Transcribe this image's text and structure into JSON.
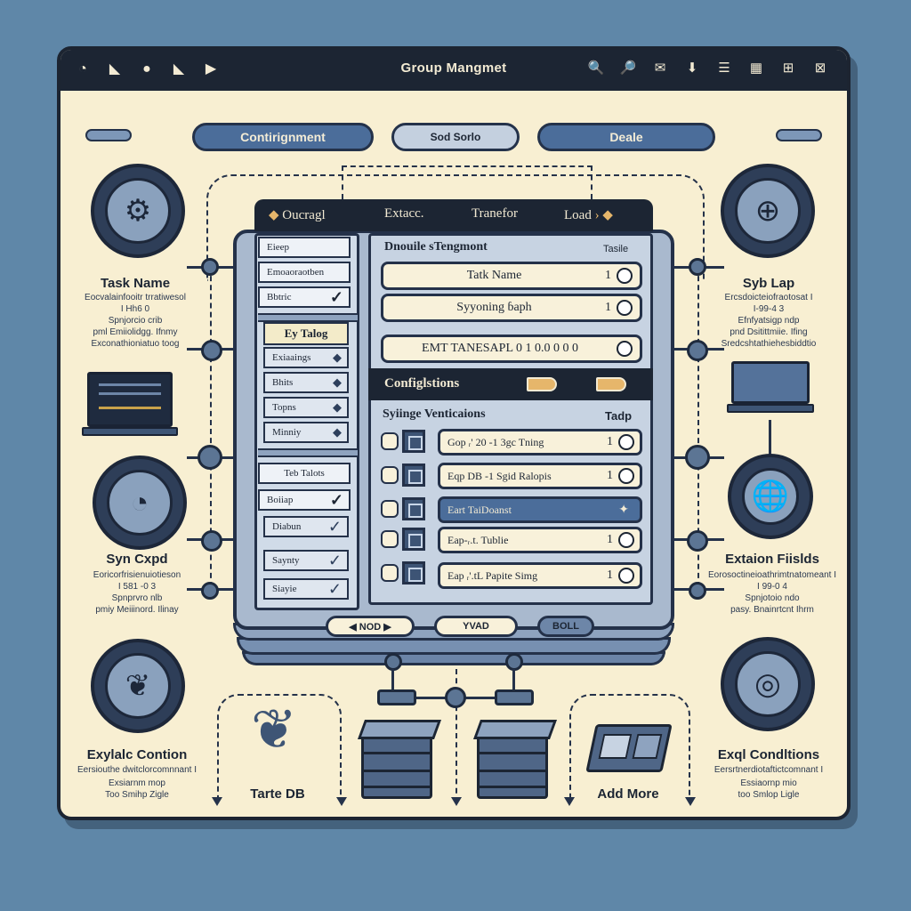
{
  "window": {
    "title": "Group Mangmet",
    "left_icons": [
      "◔",
      "◣",
      "●",
      "◣",
      "▶"
    ],
    "right_icons": [
      "🔍",
      "🔎",
      "✉",
      "⬇",
      "☰",
      "▦",
      "⊞",
      "⊠"
    ]
  },
  "top_buttons": {
    "left": "Contirignment",
    "center": "Sod Sorlo",
    "right": "Deale"
  },
  "tabs": {
    "t1": "Oucragl",
    "t2": "Extacc.",
    "t3": "Tranefor",
    "t4": "Load",
    "arrow": "›"
  },
  "left_column": {
    "items": [
      "Eieep",
      "Emoaoraotben",
      "Bbtric"
    ],
    "group1_title": "Ey Talog",
    "group1": [
      "Exiaaings",
      "Bhits",
      "Topns",
      "Minniy"
    ],
    "group2_title": "Teb Talots",
    "group2": [
      "Boiiap",
      "Diabun",
      "Saynty",
      "Siayie"
    ]
  },
  "details": {
    "title": "Dnouile sTengmont",
    "tag": "Tasile",
    "fields": [
      {
        "label": "Tatk Name",
        "num": "1"
      },
      {
        "label": "Syyoning ɓaph",
        "num": "1"
      },
      {
        "label": "EMT TANESAPL  0 1 0.0  0 0 0",
        "num": ""
      }
    ]
  },
  "config": {
    "bar_title": "Configlstions",
    "section_title": "Syiinge Venticaions",
    "section_tag": "Tadp",
    "rows": [
      {
        "label": "Gop ᵣ' 20 -1 3gc Tning",
        "num": "1",
        "selected": false
      },
      {
        "label": "Eqp DB  -1  Sgid Ralopis",
        "num": "1",
        "selected": false
      },
      {
        "label": "Eart TaiDoanst",
        "num": "",
        "selected": true
      },
      {
        "label": "Eap-ᵣ.t. Tublie",
        "num": "1",
        "selected": false
      },
      {
        "label": "Eap ᵣ'.tL Papite Simg",
        "num": "1",
        "selected": false
      }
    ]
  },
  "footer_buttons": {
    "b1": "◀ NOD ▶",
    "b2": "YVAD",
    "b3": "BOLL"
  },
  "side_left": {
    "s1_title": "Task Name",
    "s1_lines": [
      "Eocvalainfooitr trratiwesol",
      "I Hh6 0",
      "Spnjorcio crib",
      "pml Emiiolidgg. Ifnmy",
      "Exconathioniatuo toog"
    ],
    "s2_title": "Syn Cxpd",
    "s2_lines": [
      "Eoricorfrisienuiotieson",
      "I 581 -0 3",
      "Spnprvro nlb",
      "pmiy Meiiinord. Ilinay"
    ],
    "s3_title": "Exylalc Contion",
    "s3_lines": [
      "Eersiouthe dwitclorcomnnant I",
      "Exsiarnm mop",
      "Too Smihp Zigle"
    ]
  },
  "side_right": {
    "s1_title": "Syb Lap",
    "s1_lines": [
      "Ercsdoicteiofraotosat I",
      "I-99-4 3",
      "Efnfyatsigp ndp",
      "pnd Dsitittmiie. Ifing",
      "Sredcshtathiehesbiddtio"
    ],
    "s2_title": "Extaion Fiislds",
    "s2_lines": [
      "Eorosoctineioathrimtnatomeant I",
      "I 99-0 4",
      "Spnjotoio ndo",
      "pasy. Bnainrtcnt Ihrm"
    ],
    "s3_title": "Exql Condltions",
    "s3_lines": [
      "Eersrtnerdiotaftictcomnant I",
      "Essiaornp mio",
      "too Smlop Ligle"
    ]
  },
  "bottom": {
    "label_left": "Tarte DB",
    "label_right": "Add More"
  },
  "colors": {
    "background": "#5f87a8",
    "window": "#f8efd2",
    "dark": "#1c2533",
    "accent": "#4b6d9a",
    "panel": "#a9b9ce"
  }
}
